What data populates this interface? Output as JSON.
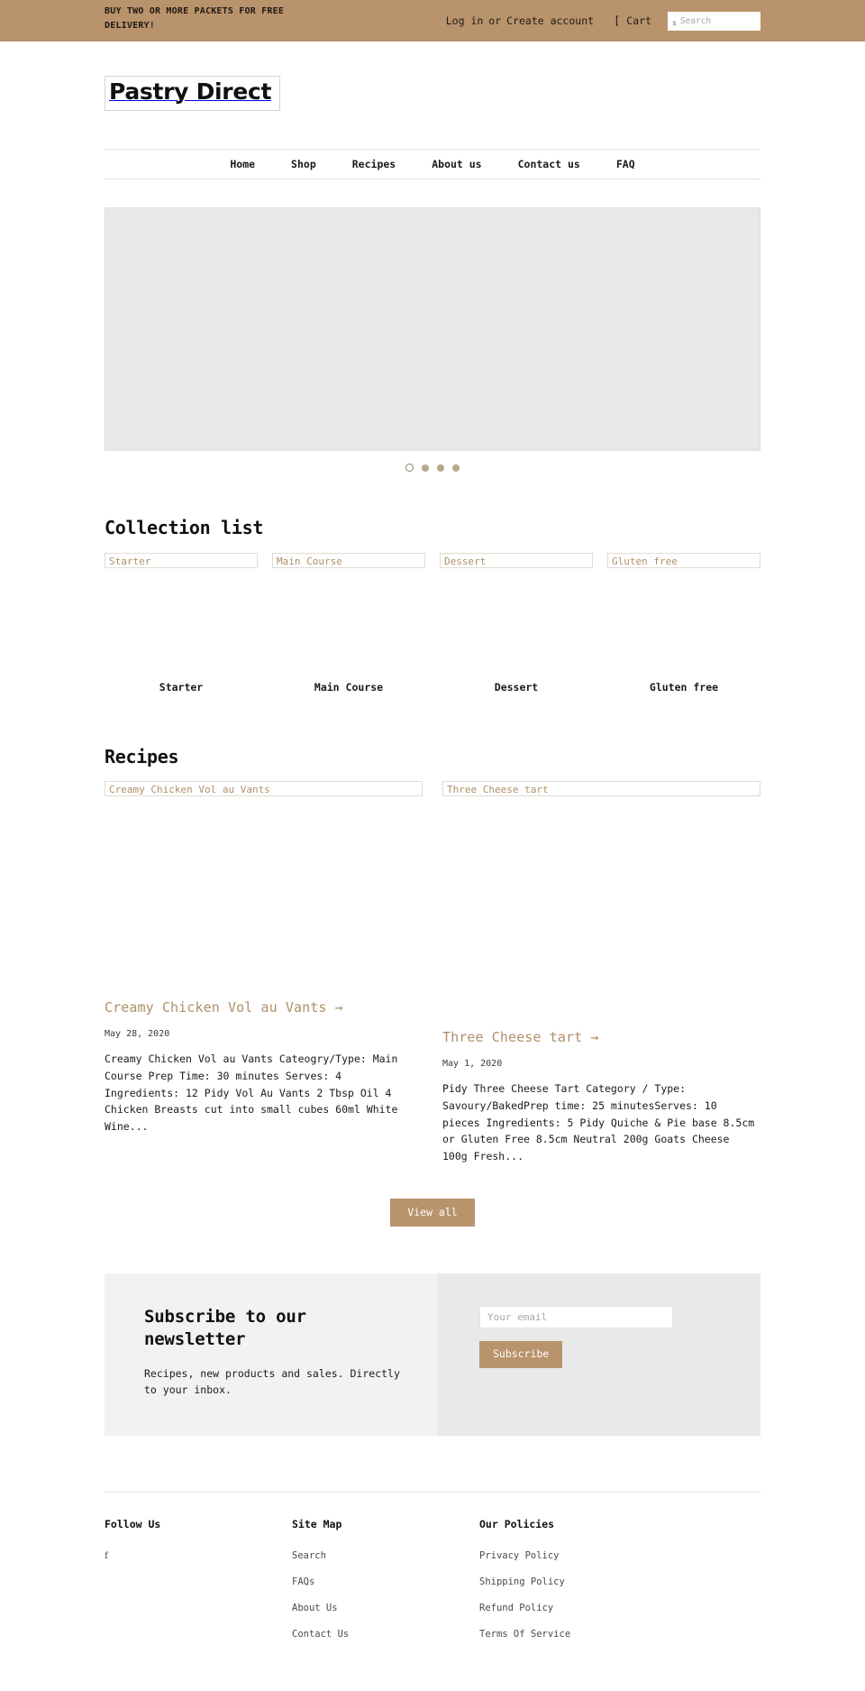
{
  "topbar": {
    "announcement": "BUY TWO OR MORE PACKETS FOR FREE DELIVERY!",
    "login_label": "Log in",
    "or_label": "or",
    "create_account_label": "Create account",
    "cart_glyph": "[",
    "cart_label": "Cart",
    "search_icon_glyph": "s",
    "search_placeholder": "Search",
    "search_value": "",
    "bg_color": "#b9936c"
  },
  "header": {
    "logo_text": "Pastry Direct"
  },
  "nav": {
    "items": [
      {
        "label": "Home"
      },
      {
        "label": "Shop"
      },
      {
        "label": "Recipes"
      },
      {
        "label": "About us"
      },
      {
        "label": "Contact us"
      },
      {
        "label": "FAQ"
      }
    ]
  },
  "hero": {
    "slide_count": 4,
    "active_index": 0
  },
  "collections": {
    "title": "Collection list",
    "items": [
      {
        "alt": "Starter",
        "label": "Starter"
      },
      {
        "alt": "Main Course",
        "label": "Main Course"
      },
      {
        "alt": "Dessert",
        "label": "Dessert"
      },
      {
        "alt": "Gluten free",
        "label": "Gluten free"
      }
    ]
  },
  "recipes": {
    "title": "Recipes",
    "items": [
      {
        "alt": "Creamy Chicken Vol au Vants",
        "title": "Creamy Chicken Vol au Vants →",
        "date": "May 28, 2020",
        "excerpt": "Creamy Chicken Vol au Vants Cateogry/Type: Main Course Prep Time: 30 minutes Serves: 4 Ingredients: 12 Pidy Vol Au Vants 2 Tbsp Oil 4 Chicken Breasts cut into small cubes 60ml White Wine..."
      },
      {
        "alt": "Three Cheese tart",
        "title": "Three Cheese tart →",
        "date": "May 1, 2020",
        "excerpt": "Pidy Three Cheese Tart Category / Type: Savoury/BakedPrep time: 25 minutesServes: 10 pieces Ingredients:  5 Pidy Quiche & Pie base 8.5cm or Gluten Free 8.5cm Neutral 200g Goats Cheese 100g Fresh..."
      }
    ],
    "view_all_label": "View all"
  },
  "newsletter": {
    "heading": "Subscribe to our newsletter",
    "subtext": "Recipes, new products and sales. Directly to your inbox.",
    "email_placeholder": "Your email",
    "email_value": "",
    "subscribe_label": "Subscribe",
    "accent_color": "#b9936c"
  },
  "footer": {
    "follow": {
      "title": "Follow Us",
      "facebook_glyph": "f"
    },
    "sitemap": {
      "title": "Site Map",
      "links": [
        {
          "label": "Search"
        },
        {
          "label": "FAQs"
        },
        {
          "label": "About Us"
        },
        {
          "label": "Contact Us"
        }
      ]
    },
    "policies": {
      "title": "Our Policies",
      "links": [
        {
          "label": "Privacy Policy"
        },
        {
          "label": "Shipping Policy"
        },
        {
          "label": "Refund Policy"
        },
        {
          "label": "Terms Of Service"
        }
      ]
    }
  }
}
